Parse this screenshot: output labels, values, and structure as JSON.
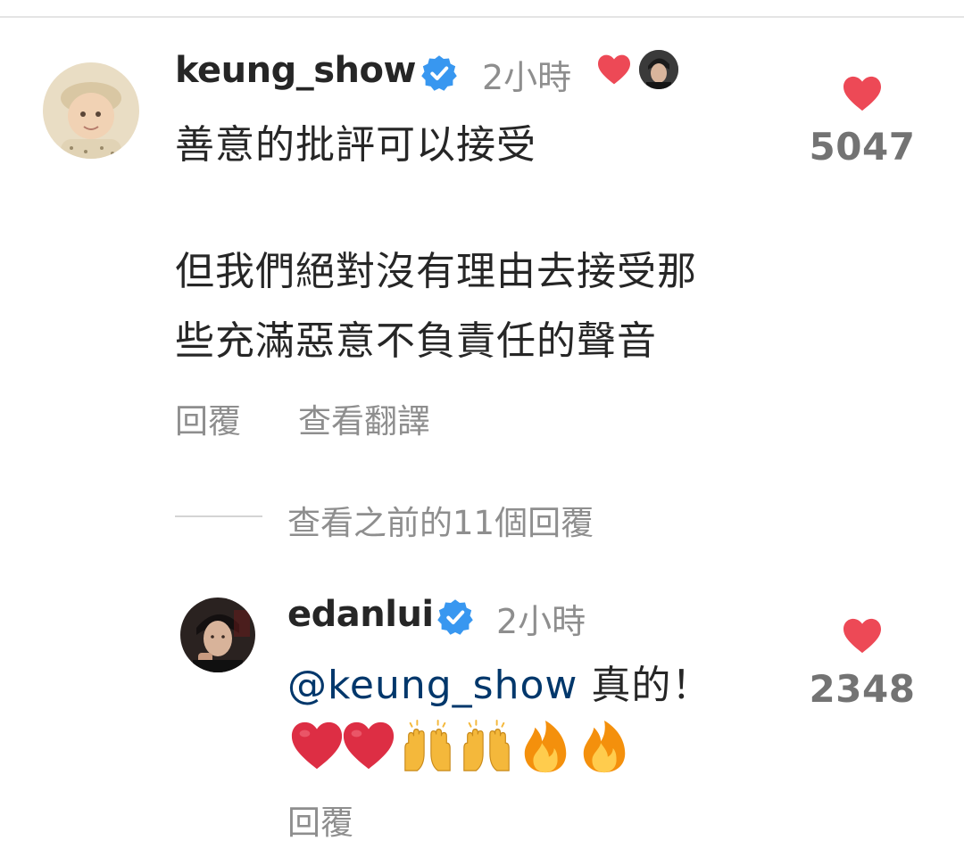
{
  "thread": {
    "comment": {
      "username": "keung_show",
      "time": "2小時",
      "text_line1": "善意的批評可以接受",
      "text_line2": "但我們絕對沒有理由去接受那\n些充滿惡意不負責任的聲音",
      "reply_label": "回覆",
      "translate_label": "查看翻譯",
      "like_count": "5047",
      "creator_liked": true
    },
    "view_previous": "查看之前的11個回覆",
    "reply": {
      "username": "edanlui",
      "time": "2小時",
      "mention": "@keung_show",
      "text": " 真的！",
      "emojis": [
        "red-heart",
        "red-heart",
        "raising-hands",
        "raising-hands",
        "fire",
        "fire"
      ],
      "reply_label": "回覆",
      "like_count": "2348"
    }
  },
  "colors": {
    "like_red": "#ed4956",
    "verified_blue": "#3897f0",
    "mention_blue": "#00376b",
    "secondary_text": "#8e8e8e"
  }
}
